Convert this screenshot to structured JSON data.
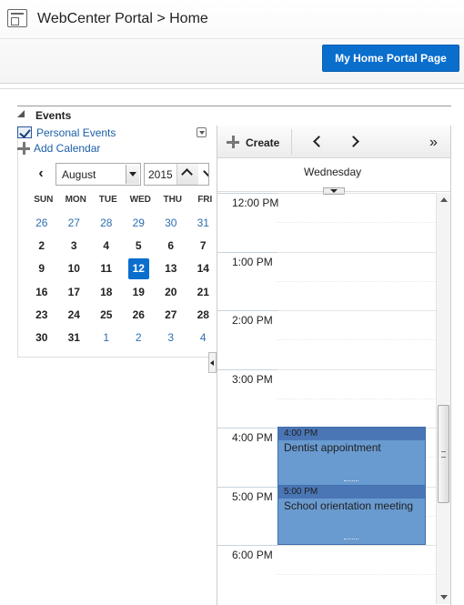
{
  "header": {
    "title": "WebCenter Portal > Home",
    "home_button": "My Home Portal Page"
  },
  "panel": {
    "title": "Events"
  },
  "calendars": {
    "personal_events": "Personal Events",
    "personal_events_checked": true,
    "add_calendar": "Add Calendar"
  },
  "mini_calendar": {
    "month": "August",
    "year": "2015",
    "weekdays": [
      "SUN",
      "MON",
      "TUE",
      "WED",
      "THU",
      "FRI"
    ],
    "weeks": [
      [
        {
          "d": "26",
          "o": true
        },
        {
          "d": "27",
          "o": true
        },
        {
          "d": "28",
          "o": true
        },
        {
          "d": "29",
          "o": true
        },
        {
          "d": "30",
          "o": true
        },
        {
          "d": "31",
          "o": true
        }
      ],
      [
        {
          "d": "2"
        },
        {
          "d": "3"
        },
        {
          "d": "4"
        },
        {
          "d": "5"
        },
        {
          "d": "6"
        },
        {
          "d": "7"
        }
      ],
      [
        {
          "d": "9"
        },
        {
          "d": "10"
        },
        {
          "d": "11"
        },
        {
          "d": "12",
          "t": true
        },
        {
          "d": "13"
        },
        {
          "d": "14"
        }
      ],
      [
        {
          "d": "16"
        },
        {
          "d": "17"
        },
        {
          "d": "18"
        },
        {
          "d": "19"
        },
        {
          "d": "20"
        },
        {
          "d": "21"
        }
      ],
      [
        {
          "d": "23"
        },
        {
          "d": "24"
        },
        {
          "d": "25"
        },
        {
          "d": "26"
        },
        {
          "d": "27"
        },
        {
          "d": "28"
        }
      ],
      [
        {
          "d": "30"
        },
        {
          "d": "31"
        },
        {
          "d": "1",
          "o": true
        },
        {
          "d": "2",
          "o": true
        },
        {
          "d": "3",
          "o": true
        },
        {
          "d": "4",
          "o": true
        }
      ]
    ]
  },
  "toolbar": {
    "create_label": "Create",
    "overflow": "»"
  },
  "day_view": {
    "day_name": "Wednesday",
    "hours": [
      "12:00 PM",
      "1:00 PM",
      "2:00 PM",
      "3:00 PM",
      "4:00 PM",
      "5:00 PM",
      "6:00 PM"
    ],
    "events": [
      {
        "time": "4:00 PM",
        "title": "Dentist appointment"
      },
      {
        "time": "5:00 PM",
        "title": "School orientation meeting"
      }
    ]
  },
  "colors": {
    "accent": "#0a6ecd",
    "event_fill": "#6a9bd0",
    "event_header": "#4a76b5",
    "link": "#1b5fa8"
  }
}
